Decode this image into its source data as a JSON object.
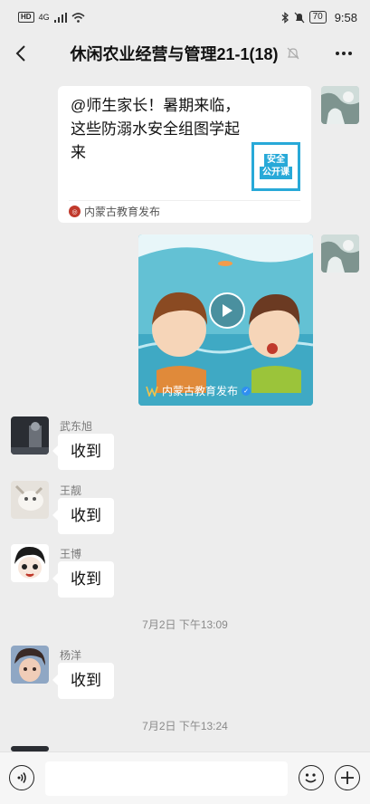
{
  "status_bar": {
    "hd_badge": "HD",
    "network": "4G",
    "battery": "70",
    "time": "9:58"
  },
  "header": {
    "title": "休闲农业经营与管理21-1(18)",
    "back_icon": "chevron-left-icon",
    "mute_icon": "bell-off-icon",
    "more_icon": "more-dots-icon"
  },
  "messages": {
    "card": {
      "title": "@师生家长！暑期来临，这些防溺水安全组图学起来",
      "thumb_line1": "安全",
      "thumb_line2": "公开课",
      "source": "内蒙古教育发布"
    },
    "video": {
      "source": "内蒙古教育发布"
    },
    "items": [
      {
        "name": "武东旭",
        "text": "收到"
      },
      {
        "name": "王靓",
        "text": "收到"
      },
      {
        "name": "王博",
        "text": "收到"
      },
      {
        "name": "杨洋",
        "text": "收到"
      }
    ],
    "timestamps": [
      "7月2日 下午13:09",
      "7月2日 下午13:24"
    ]
  },
  "input_bar": {
    "placeholder": "",
    "voice_icon": "voice-icon",
    "emoji_icon": "emoji-icon",
    "plus_icon": "plus-icon"
  },
  "colors": {
    "background": "#ededed",
    "bubble": "#ffffff",
    "accent_blue": "#28a9d8"
  }
}
